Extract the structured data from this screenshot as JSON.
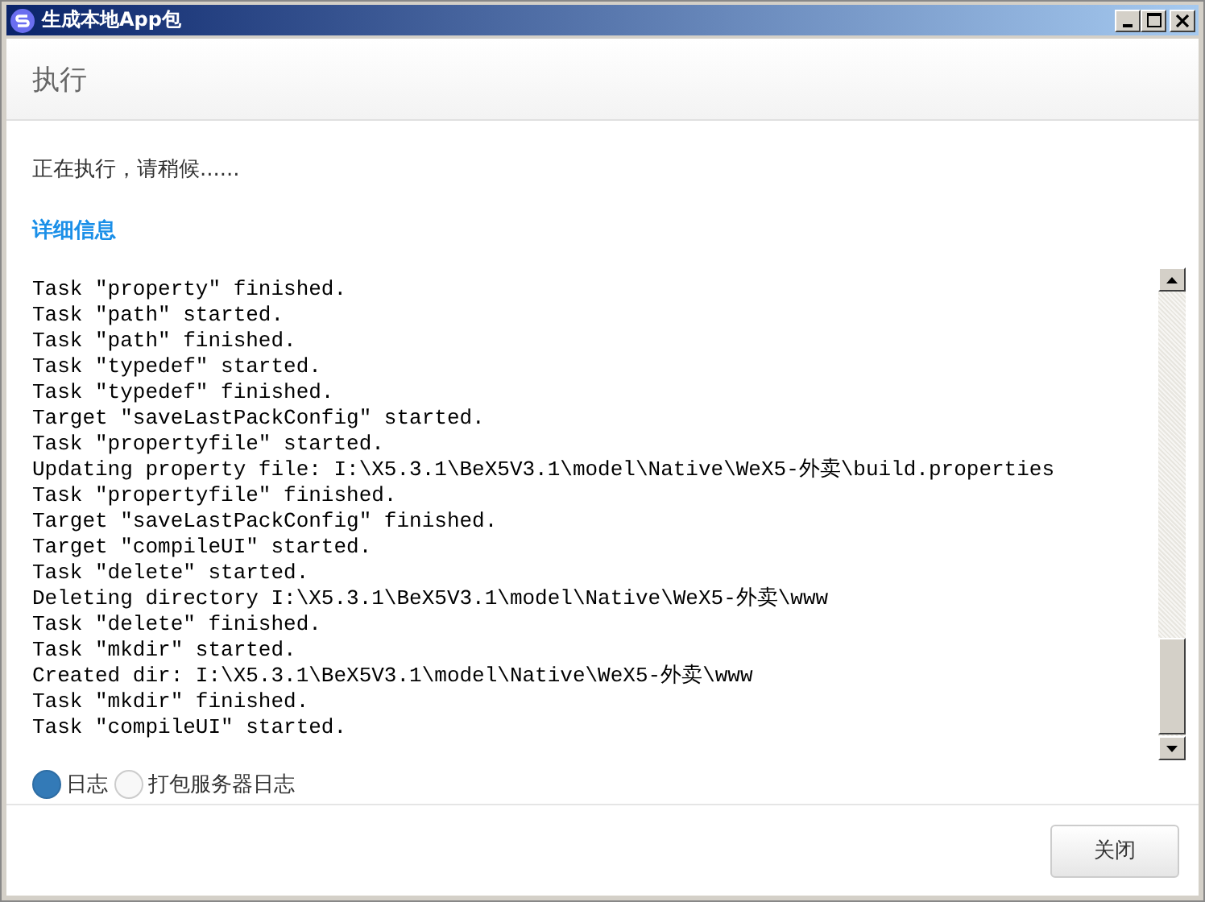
{
  "window": {
    "title": "生成本地App包"
  },
  "header": {
    "title": "执行"
  },
  "status_text": "正在执行，请稍候......",
  "details_link": "详细信息",
  "log_lines": [
    "Task \"property\" finished.",
    "Task \"path\" started.",
    "Task \"path\" finished.",
    "Task \"typedef\" started.",
    "Task \"typedef\" finished.",
    "Target \"saveLastPackConfig\" started.",
    "Task \"propertyfile\" started.",
    "Updating property file: I:\\X5.3.1\\BeX5V3.1\\model\\Native\\WeX5-外卖\\build.properties",
    "Task \"propertyfile\" finished.",
    "Target \"saveLastPackConfig\" finished.",
    "Target \"compileUI\" started.",
    "Task \"delete\" started.",
    "Deleting directory I:\\X5.3.1\\BeX5V3.1\\model\\Native\\WeX5-外卖\\www",
    "Task \"delete\" finished.",
    "Task \"mkdir\" started.",
    "Created dir: I:\\X5.3.1\\BeX5V3.1\\model\\Native\\WeX5-外卖\\www",
    "Task \"mkdir\" finished.",
    "Task \"compileUI\" started."
  ],
  "log_sources": [
    {
      "label": "日志",
      "selected": true
    },
    {
      "label": "打包服务器日志",
      "selected": false
    }
  ],
  "buttons": [
    "关闭"
  ]
}
